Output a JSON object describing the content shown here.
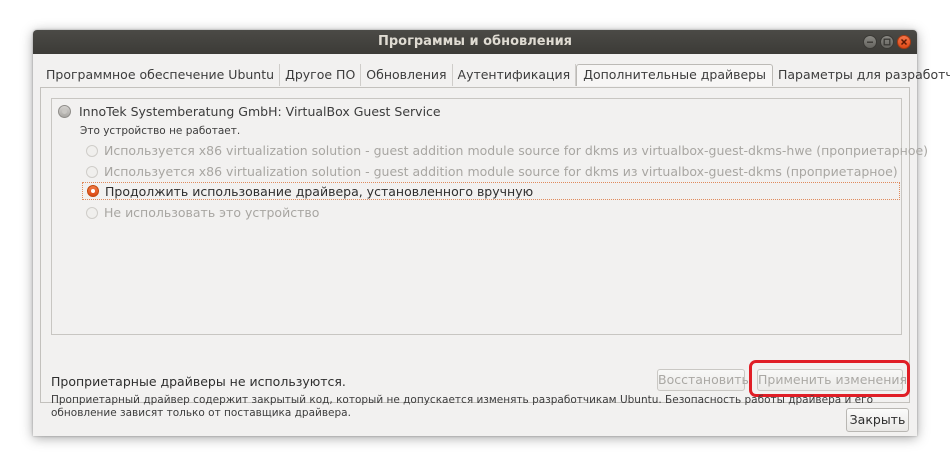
{
  "window": {
    "title": "Программы и обновления"
  },
  "tabs": [
    {
      "label": "Программное обеспечение Ubuntu",
      "active": false
    },
    {
      "label": "Другое ПО",
      "active": false
    },
    {
      "label": "Обновления",
      "active": false
    },
    {
      "label": "Аутентификация",
      "active": false
    },
    {
      "label": "Дополнительные драйверы",
      "active": true
    },
    {
      "label": "Параметры для разработчиков",
      "active": false
    }
  ],
  "device": {
    "name": "InnoTek Systemberatung GmbH: VirtualBox Guest Service",
    "status": "Это устройство не работает.",
    "options": [
      {
        "label": "Используется x86 virtualization solution - guest addition module source for dkms из virtualbox-guest-dkms-hwe (проприетарное)",
        "state": "disabled"
      },
      {
        "label": "Используется x86 virtualization solution - guest addition module source for dkms из virtualbox-guest-dkms (проприетарное)",
        "state": "disabled"
      },
      {
        "label": "Продолжить использование драйвера, установленного вручную",
        "state": "selected"
      },
      {
        "label": "Не использовать это устройство",
        "state": "disabled"
      }
    ]
  },
  "footer": {
    "status_text": "Проприетарные драйверы не используются.",
    "restore_label": "Восстановить",
    "apply_label": "Применить изменения",
    "note": "Проприетарный драйвер содержит закрытый код, который не допускается изменять разработчикам Ubuntu. Безопасность работы драйвера и его обновление зависят только от поставщика драйвера."
  },
  "close_label": "Закрыть",
  "colors": {
    "accent": "#dd4814",
    "highlight": "#e01e26",
    "titlebar": "#3c3b37"
  }
}
